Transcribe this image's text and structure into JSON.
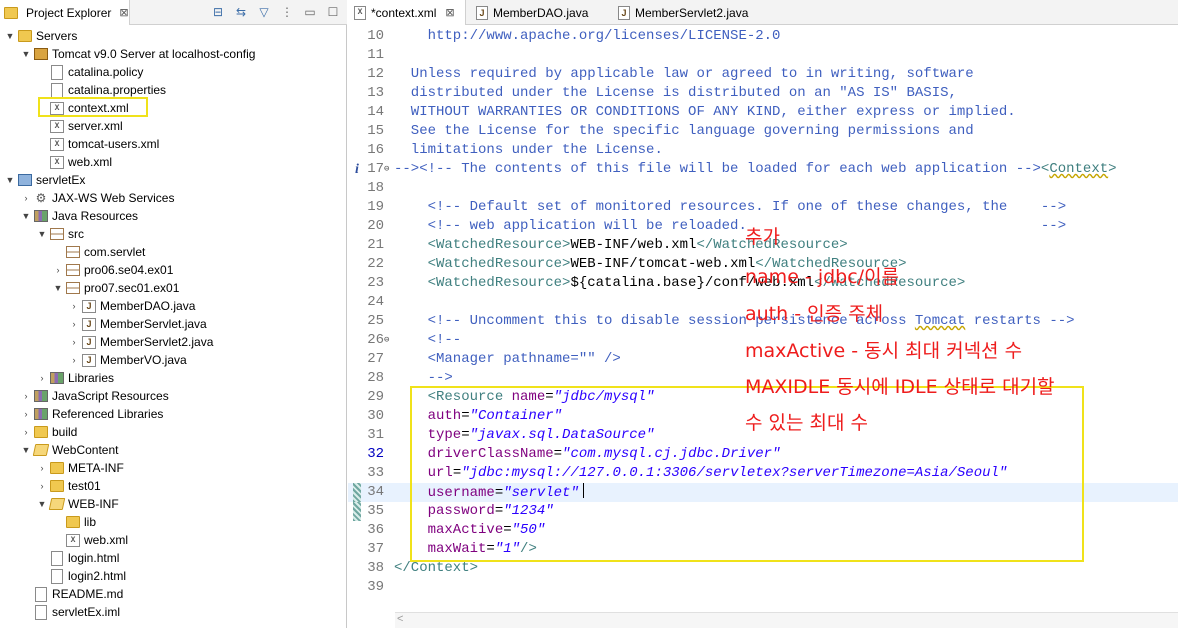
{
  "explorer": {
    "tab_label": "Project Explorer",
    "close_glyph": "⊠",
    "tools": [
      "collapse-all-icon",
      "link-with-editor-icon",
      "filter-icon",
      "view-menu-icon",
      "minimize-icon",
      "maximize-icon"
    ],
    "tree": [
      {
        "depth": 0,
        "twisty": "▼",
        "icon": "folder",
        "label": "Servers"
      },
      {
        "depth": 1,
        "twisty": "▼",
        "icon": "server",
        "label": "Tomcat v9.0 Server at localhost-config"
      },
      {
        "depth": 2,
        "twisty": "",
        "icon": "file",
        "label": "catalina.policy"
      },
      {
        "depth": 2,
        "twisty": "",
        "icon": "file",
        "label": "catalina.properties"
      },
      {
        "depth": 2,
        "twisty": "",
        "icon": "xml",
        "label": "context.xml"
      },
      {
        "depth": 2,
        "twisty": "",
        "icon": "xml",
        "label": "server.xml"
      },
      {
        "depth": 2,
        "twisty": "",
        "icon": "xml",
        "label": "tomcat-users.xml"
      },
      {
        "depth": 2,
        "twisty": "",
        "icon": "xml",
        "label": "web.xml"
      },
      {
        "depth": 0,
        "twisty": "▼",
        "icon": "project",
        "label": "servletEx"
      },
      {
        "depth": 1,
        "twisty": "›",
        "icon": "gear",
        "label": "JAX-WS Web Services"
      },
      {
        "depth": 1,
        "twisty": "▼",
        "icon": "lib",
        "label": "Java Resources"
      },
      {
        "depth": 2,
        "twisty": "▼",
        "icon": "package",
        "label": "src"
      },
      {
        "depth": 3,
        "twisty": "",
        "icon": "package",
        "label": "com.servlet"
      },
      {
        "depth": 3,
        "twisty": "›",
        "icon": "package",
        "label": "pro06.se04.ex01"
      },
      {
        "depth": 3,
        "twisty": "▼",
        "icon": "package",
        "label": "pro07.sec01.ex01"
      },
      {
        "depth": 4,
        "twisty": "›",
        "icon": "java",
        "label": "MemberDAO.java"
      },
      {
        "depth": 4,
        "twisty": "›",
        "icon": "java",
        "label": "MemberServlet.java"
      },
      {
        "depth": 4,
        "twisty": "›",
        "icon": "java",
        "label": "MemberServlet2.java"
      },
      {
        "depth": 4,
        "twisty": "›",
        "icon": "java",
        "label": "MemberVO.java"
      },
      {
        "depth": 2,
        "twisty": "›",
        "icon": "lib",
        "label": "Libraries"
      },
      {
        "depth": 1,
        "twisty": "›",
        "icon": "lib",
        "label": "JavaScript Resources"
      },
      {
        "depth": 1,
        "twisty": "›",
        "icon": "lib",
        "label": "Referenced Libraries"
      },
      {
        "depth": 1,
        "twisty": "›",
        "icon": "folder",
        "label": "build"
      },
      {
        "depth": 1,
        "twisty": "▼",
        "icon": "open",
        "label": "WebContent"
      },
      {
        "depth": 2,
        "twisty": "›",
        "icon": "folder",
        "label": "META-INF"
      },
      {
        "depth": 2,
        "twisty": "›",
        "icon": "folder",
        "label": "test01"
      },
      {
        "depth": 2,
        "twisty": "▼",
        "icon": "open",
        "label": "WEB-INF"
      },
      {
        "depth": 3,
        "twisty": "",
        "icon": "folder",
        "label": "lib"
      },
      {
        "depth": 3,
        "twisty": "",
        "icon": "xml",
        "label": "web.xml"
      },
      {
        "depth": 2,
        "twisty": "",
        "icon": "file",
        "label": "login.html"
      },
      {
        "depth": 2,
        "twisty": "",
        "icon": "file",
        "label": "login2.html"
      },
      {
        "depth": 1,
        "twisty": "",
        "icon": "file",
        "label": "README.md"
      },
      {
        "depth": 1,
        "twisty": "",
        "icon": "file",
        "label": "servletEx.iml"
      }
    ]
  },
  "editor": {
    "tabs": [
      {
        "label": "*context.xml",
        "type": "xml",
        "active": true,
        "close": "⊠"
      },
      {
        "label": "MemberDAO.java",
        "type": "java",
        "active": false,
        "close": ""
      },
      {
        "label": "MemberServlet2.java",
        "type": "java",
        "active": false,
        "close": ""
      }
    ],
    "lines": [
      {
        "n": "10",
        "tokens": [
          [
            "c-com",
            "    http://www.apache.org/licenses/LICENSE-2.0"
          ]
        ]
      },
      {
        "n": "11",
        "tokens": []
      },
      {
        "n": "12",
        "tokens": [
          [
            "c-com",
            "  Unless required by applicable law or agreed to in writing, software"
          ]
        ]
      },
      {
        "n": "13",
        "tokens": [
          [
            "c-com",
            "  distributed under the License is distributed on an \"AS IS\" BASIS,"
          ]
        ]
      },
      {
        "n": "14",
        "tokens": [
          [
            "c-com",
            "  WITHOUT WARRANTIES OR CONDITIONS OF ANY KIND, either express or implied."
          ]
        ]
      },
      {
        "n": "15",
        "tokens": [
          [
            "c-com",
            "  See the License for the specific language governing permissions and"
          ]
        ]
      },
      {
        "n": "16",
        "tokens": [
          [
            "c-com",
            "  limitations under the License."
          ]
        ]
      },
      {
        "n": "17",
        "mark": "info",
        "fold": "⊖",
        "tokens": [
          [
            "c-com",
            "--><!-- The contents of this file will be loaded for each web application -->"
          ],
          [
            "c-tag",
            "<"
          ],
          [
            "c-tag c-wavy",
            "Context"
          ],
          [
            "c-tag",
            ">"
          ]
        ]
      },
      {
        "n": "18",
        "tokens": []
      },
      {
        "n": "19",
        "tokens": [
          [
            "c-com",
            "    <!-- Default set of monitored resources. If one of these changes, the    -->"
          ]
        ]
      },
      {
        "n": "20",
        "tokens": [
          [
            "c-com",
            "    <!-- web application will be reloaded.                                   -->"
          ]
        ]
      },
      {
        "n": "21",
        "tokens": [
          [
            "c-tag",
            "    <WatchedResource>"
          ],
          [
            "c-txt",
            "WEB-INF/web.xml"
          ],
          [
            "c-tag",
            "</WatchedResource>"
          ]
        ]
      },
      {
        "n": "22",
        "tokens": [
          [
            "c-tag",
            "    <WatchedResource>"
          ],
          [
            "c-txt",
            "WEB-INF/tomcat-web.xml"
          ],
          [
            "c-tag",
            "</WatchedResource>"
          ]
        ]
      },
      {
        "n": "23",
        "tokens": [
          [
            "c-tag",
            "    <WatchedResource>"
          ],
          [
            "c-txt",
            "${catalina.base}/conf/web.xml"
          ],
          [
            "c-tag",
            "</WatchedResource>"
          ]
        ]
      },
      {
        "n": "24",
        "tokens": []
      },
      {
        "n": "25",
        "tokens": [
          [
            "c-com",
            "    <!-- Uncomment this to disable session persistence across "
          ],
          [
            "c-com c-wavy",
            "Tomcat"
          ],
          [
            "c-com",
            " restarts -->"
          ]
        ]
      },
      {
        "n": "26",
        "fold": "⊖",
        "tokens": [
          [
            "c-com",
            "    <!--"
          ]
        ]
      },
      {
        "n": "27",
        "tokens": [
          [
            "c-com",
            "    <Manager pathname=\"\" />"
          ]
        ]
      },
      {
        "n": "28",
        "tokens": [
          [
            "c-com",
            "    -->"
          ]
        ]
      },
      {
        "n": "29",
        "tokens": [
          [
            "c-tag",
            "    <Resource "
          ],
          [
            "c-attr",
            "name"
          ],
          [
            "c-txt",
            "="
          ],
          [
            "c-val",
            "\"jdbc/mysql\""
          ]
        ]
      },
      {
        "n": "30",
        "tokens": [
          [
            "c-attr",
            "    auth"
          ],
          [
            "c-txt",
            "="
          ],
          [
            "c-val",
            "\"Container\""
          ]
        ]
      },
      {
        "n": "31",
        "tokens": [
          [
            "c-attr",
            "    type"
          ],
          [
            "c-txt",
            "="
          ],
          [
            "c-val",
            "\"javax.sql.DataSource\""
          ]
        ]
      },
      {
        "n": "32",
        "mod": true,
        "tokens": [
          [
            "c-attr",
            "    driverClassName"
          ],
          [
            "c-txt",
            "="
          ],
          [
            "c-val",
            "\"com.mysql.cj.jdbc.Driver\""
          ]
        ]
      },
      {
        "n": "33",
        "tokens": [
          [
            "c-attr",
            "    url"
          ],
          [
            "c-txt",
            "="
          ],
          [
            "c-val",
            "\"jdbc:mysql://127.0.0.1:3306/servletex?serverTimezone=Asia/Seoul\""
          ]
        ]
      },
      {
        "n": "34",
        "mark": "change",
        "current": true,
        "caret": true,
        "tokens": [
          [
            "c-attr",
            "    username"
          ],
          [
            "c-txt",
            "="
          ],
          [
            "c-val",
            "\"servlet\""
          ]
        ]
      },
      {
        "n": "35",
        "mark": "change",
        "tokens": [
          [
            "c-attr",
            "    password"
          ],
          [
            "c-txt",
            "="
          ],
          [
            "c-val",
            "\"1234\""
          ]
        ]
      },
      {
        "n": "36",
        "tokens": [
          [
            "c-attr",
            "    maxActive"
          ],
          [
            "c-txt",
            "="
          ],
          [
            "c-val",
            "\"50\""
          ]
        ]
      },
      {
        "n": "37",
        "tokens": [
          [
            "c-attr",
            "    maxWait"
          ],
          [
            "c-txt",
            "="
          ],
          [
            "c-val",
            "\"1\""
          ],
          [
            "c-tag",
            "/>"
          ]
        ]
      },
      {
        "n": "38",
        "tokens": [
          [
            "c-tag",
            "</Context>"
          ]
        ]
      },
      {
        "n": "39",
        "tokens": []
      }
    ],
    "scroll_left_glyph": "<"
  },
  "annotations": [
    "추가",
    "name - jdbc/이름",
    "auth - 인증 주체",
    "maxActive - 동시 최대 커넥션 수",
    "MAXIDLE 동시에 IDLE 상태로 대기할",
    "수 있는 최대 수"
  ],
  "colors": {
    "highlight_box": "#f0e21a",
    "annotation_text": "#ee1c1c",
    "comment": "#3f5fbf",
    "tag": "#3f7f7f",
    "attribute": "#7f007f",
    "value": "#2a00ff"
  }
}
